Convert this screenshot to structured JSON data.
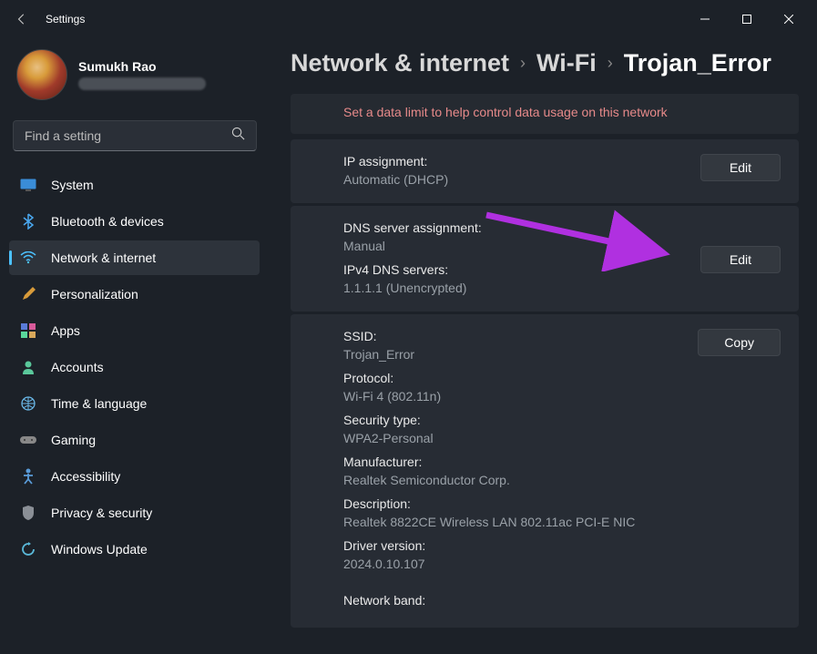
{
  "app": {
    "title": "Settings"
  },
  "profile": {
    "name": "Sumukh Rao"
  },
  "search": {
    "placeholder": "Find a setting"
  },
  "sidebar": {
    "items": [
      {
        "icon": "system",
        "label": "System"
      },
      {
        "icon": "bluetooth",
        "label": "Bluetooth & devices"
      },
      {
        "icon": "wifi",
        "label": "Network & internet"
      },
      {
        "icon": "brush",
        "label": "Personalization"
      },
      {
        "icon": "apps",
        "label": "Apps"
      },
      {
        "icon": "account",
        "label": "Accounts"
      },
      {
        "icon": "globe",
        "label": "Time & language"
      },
      {
        "icon": "gaming",
        "label": "Gaming"
      },
      {
        "icon": "accessibility",
        "label": "Accessibility"
      },
      {
        "icon": "shield",
        "label": "Privacy & security"
      },
      {
        "icon": "update",
        "label": "Windows Update"
      }
    ]
  },
  "breadcrumb": {
    "crumb1": "Network & internet",
    "crumb2": "Wi-Fi",
    "crumb3": "Trojan_Error"
  },
  "banner": {
    "text": "Set a data limit to help control data usage on this network"
  },
  "buttons": {
    "edit": "Edit",
    "copy": "Copy"
  },
  "ip": {
    "label": "IP assignment:",
    "value": "Automatic (DHCP)"
  },
  "dns": {
    "assignment_label": "DNS server assignment:",
    "assignment_value": "Manual",
    "servers_label": "IPv4 DNS servers:",
    "servers_value": "1.1.1.1 (Unencrypted)"
  },
  "details": {
    "ssid_label": "SSID:",
    "ssid_value": "Trojan_Error",
    "protocol_label": "Protocol:",
    "protocol_value": "Wi-Fi 4 (802.11n)",
    "security_label": "Security type:",
    "security_value": "WPA2-Personal",
    "manufacturer_label": "Manufacturer:",
    "manufacturer_value": "Realtek Semiconductor Corp.",
    "description_label": "Description:",
    "description_value": "Realtek 8822CE Wireless LAN 802.11ac PCI-E NIC",
    "driver_label": "Driver version:",
    "driver_value": "2024.0.10.107",
    "band_label": "Network band:"
  }
}
